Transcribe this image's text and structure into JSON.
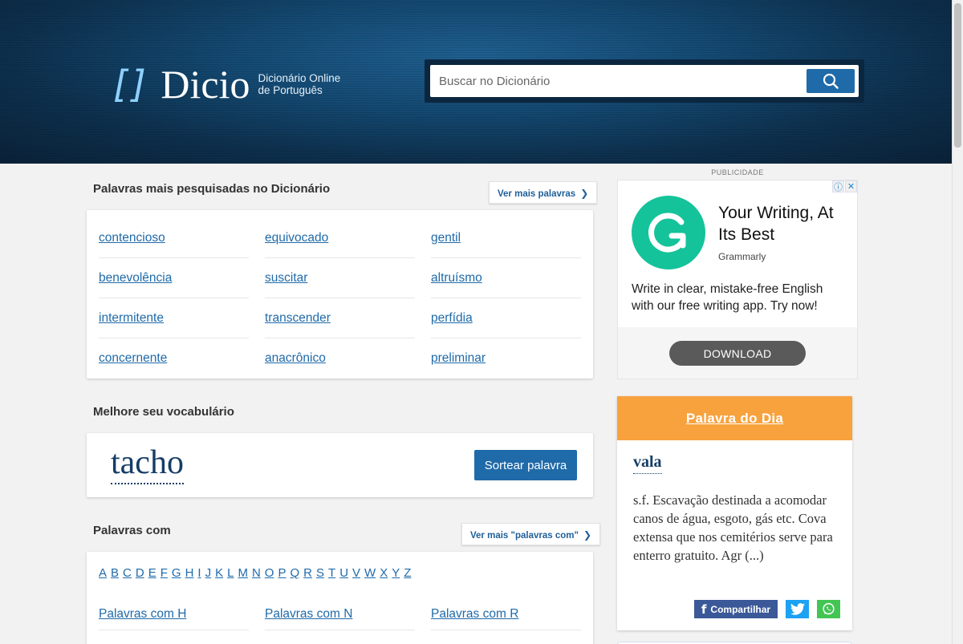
{
  "header": {
    "logo_brackets": "[]",
    "logo_word": "Dicio",
    "tagline_line1": "Dicionário Online",
    "tagline_line2": "de Português",
    "search_placeholder": "Buscar no Dicionário"
  },
  "most_searched": {
    "title": "Palavras mais pesquisadas no Dicionário",
    "more_label": "Ver mais palavras",
    "rows": [
      [
        "contencioso",
        "equivocado",
        "gentil"
      ],
      [
        "benevolência",
        "suscitar",
        "altruísmo"
      ],
      [
        "intermitente",
        "transcender",
        "perfídia"
      ],
      [
        "concernente",
        "anacrônico",
        "preliminar"
      ]
    ]
  },
  "vocabulary": {
    "title": "Melhore seu vocabulário",
    "word": "tacho",
    "button_label": "Sortear palavra"
  },
  "words_with": {
    "title": "Palavras com",
    "more_label": "Ver mais \"palavras com\"",
    "letters": [
      "A",
      "B",
      "C",
      "D",
      "E",
      "F",
      "G",
      "H",
      "I",
      "J",
      "K",
      "L",
      "M",
      "N",
      "O",
      "P",
      "Q",
      "R",
      "S",
      "T",
      "U",
      "V",
      "W",
      "X",
      "Y",
      "Z"
    ],
    "links": [
      "Palavras com H",
      "Palavras com N",
      "Palavras com R"
    ]
  },
  "ad": {
    "label": "PUBLICIDADE",
    "headline": "Your Writing, At Its Best",
    "brand": "Grammarly",
    "body": "Write in clear, mistake-free English with our free writing app. Try now!",
    "cta": "DOWNLOAD",
    "logo_color": "#15c39a"
  },
  "word_of_day": {
    "title": "Palavra do Dia",
    "word": "vala",
    "definition": "s.f. Escavação destinada a acomodar canos de água, esgoto, gás etc. Cova extensa que nos cemitérios serve para enterro gratuito. Agr (...)",
    "share_label": "Compartilhar",
    "header_color": "#f8a23d"
  },
  "colors": {
    "link": "#1f6aa9",
    "primary_button": "#1f6aa9",
    "facebook": "#3b5998",
    "twitter": "#1da1f2",
    "whatsapp": "#43c553"
  }
}
